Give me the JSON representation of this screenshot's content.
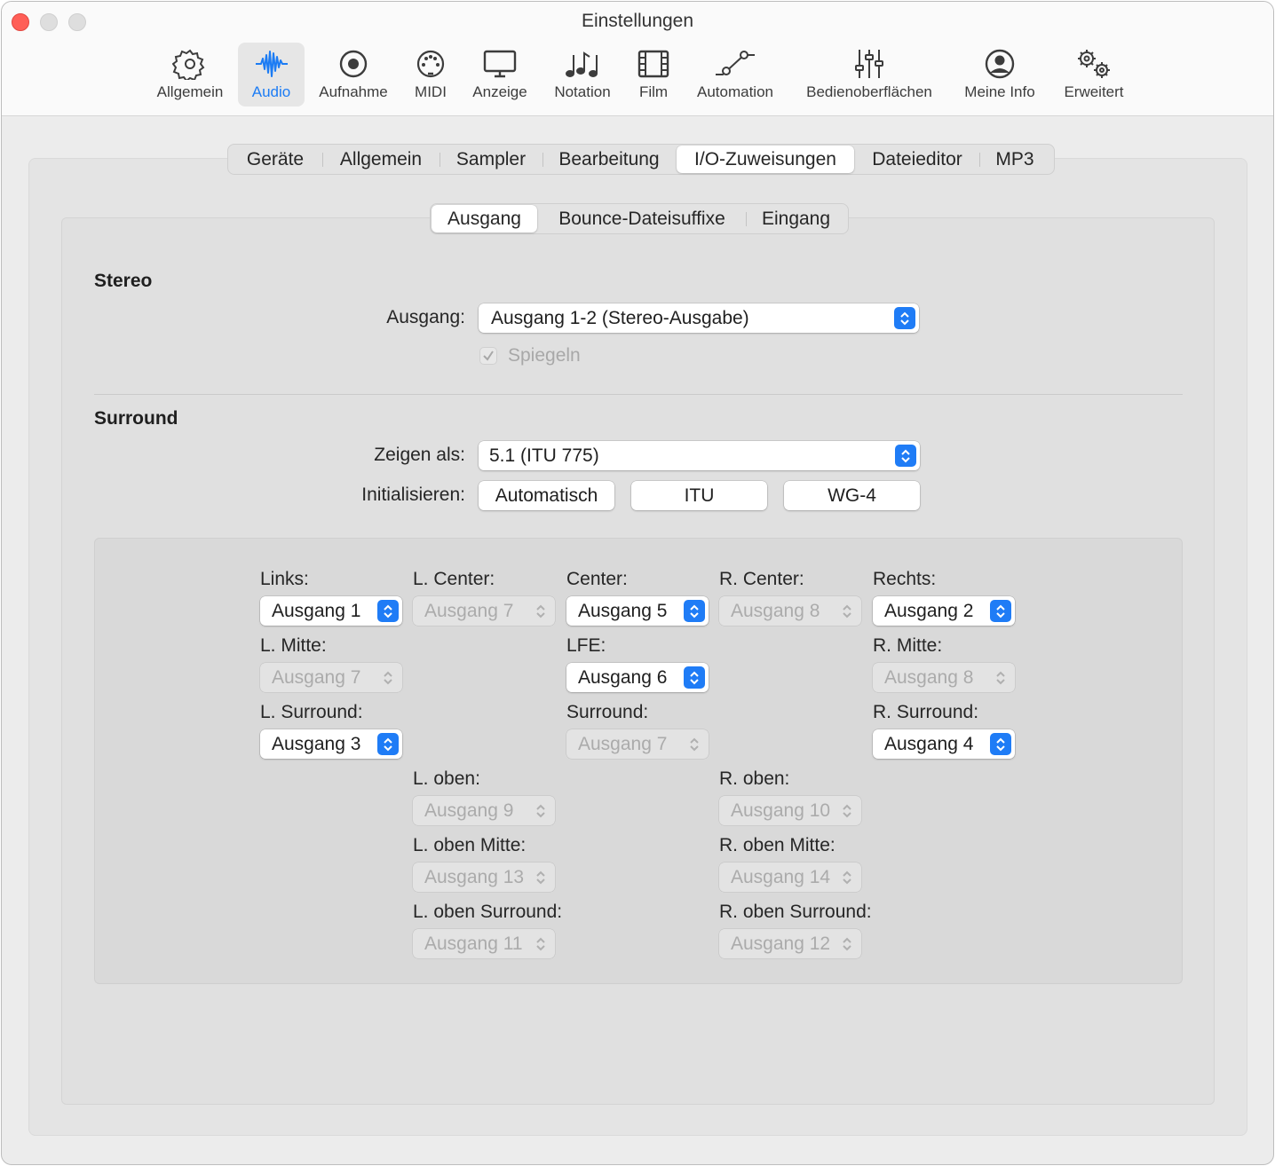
{
  "window": {
    "title": "Einstellungen"
  },
  "toolbar": {
    "items": [
      {
        "label": "Allgemein",
        "icon": "gear-icon"
      },
      {
        "label": "Audio",
        "icon": "waveform-icon",
        "selected": true
      },
      {
        "label": "Aufnahme",
        "icon": "record-icon"
      },
      {
        "label": "MIDI",
        "icon": "midi-icon"
      },
      {
        "label": "Anzeige",
        "icon": "display-icon"
      },
      {
        "label": "Notation",
        "icon": "notes-icon"
      },
      {
        "label": "Film",
        "icon": "film-icon"
      },
      {
        "label": "Automation",
        "icon": "automation-icon"
      },
      {
        "label": "Bedienoberflächen",
        "icon": "sliders-icon"
      },
      {
        "label": "Meine Info",
        "icon": "person-icon"
      },
      {
        "label": "Erweitert",
        "icon": "gears-icon"
      }
    ]
  },
  "tabs": {
    "items": [
      "Geräte",
      "Allgemein",
      "Sampler",
      "Bearbeitung",
      "I/O-Zuweisungen",
      "Dateieditor",
      "MP3"
    ],
    "active": "I/O-Zuweisungen"
  },
  "subtabs": {
    "items": [
      "Ausgang",
      "Bounce-Dateisuffixe",
      "Eingang"
    ],
    "active": "Ausgang"
  },
  "stereo": {
    "title": "Stereo",
    "output_label": "Ausgang:",
    "output_value": "Ausgang 1-2 (Stereo-Ausgabe)",
    "mirror_label": "Spiegeln",
    "mirror_checked": true
  },
  "surround": {
    "title": "Surround",
    "show_as_label": "Zeigen als:",
    "show_as_value": "5.1 (ITU 775)",
    "init_label": "Initialisieren:",
    "init_buttons": [
      "Automatisch",
      "ITU",
      "WG-4"
    ],
    "channels": {
      "links": {
        "label": "Links:",
        "value": "Ausgang 1",
        "enabled": true
      },
      "l_center": {
        "label": "L. Center:",
        "value": "Ausgang 7",
        "enabled": false
      },
      "center": {
        "label": "Center:",
        "value": "Ausgang 5",
        "enabled": true
      },
      "r_center": {
        "label": "R. Center:",
        "value": "Ausgang 8",
        "enabled": false
      },
      "rechts": {
        "label": "Rechts:",
        "value": "Ausgang 2",
        "enabled": true
      },
      "l_mitte": {
        "label": "L. Mitte:",
        "value": "Ausgang 7",
        "enabled": false
      },
      "lfe": {
        "label": "LFE:",
        "value": "Ausgang 6",
        "enabled": true
      },
      "r_mitte": {
        "label": "R. Mitte:",
        "value": "Ausgang 8",
        "enabled": false
      },
      "l_surround": {
        "label": "L. Surround:",
        "value": "Ausgang 3",
        "enabled": true
      },
      "surround": {
        "label": "Surround:",
        "value": "Ausgang 7",
        "enabled": false
      },
      "r_surround": {
        "label": "R. Surround:",
        "value": "Ausgang 4",
        "enabled": true
      },
      "l_oben": {
        "label": "L. oben:",
        "value": "Ausgang 9",
        "enabled": false
      },
      "r_oben": {
        "label": "R. oben:",
        "value": "Ausgang 10",
        "enabled": false
      },
      "l_oben_mitte": {
        "label": "L. oben Mitte:",
        "value": "Ausgang 13",
        "enabled": false
      },
      "r_oben_mitte": {
        "label": "R. oben Mitte:",
        "value": "Ausgang 14",
        "enabled": false
      },
      "l_oben_surround": {
        "label": "L. oben Surround:",
        "value": "Ausgang 11",
        "enabled": false
      },
      "r_oben_surround": {
        "label": "R. oben Surround:",
        "value": "Ausgang 12",
        "enabled": false
      }
    }
  },
  "colors": {
    "accent": "#1f7cf6",
    "close": "#ff5f57"
  }
}
